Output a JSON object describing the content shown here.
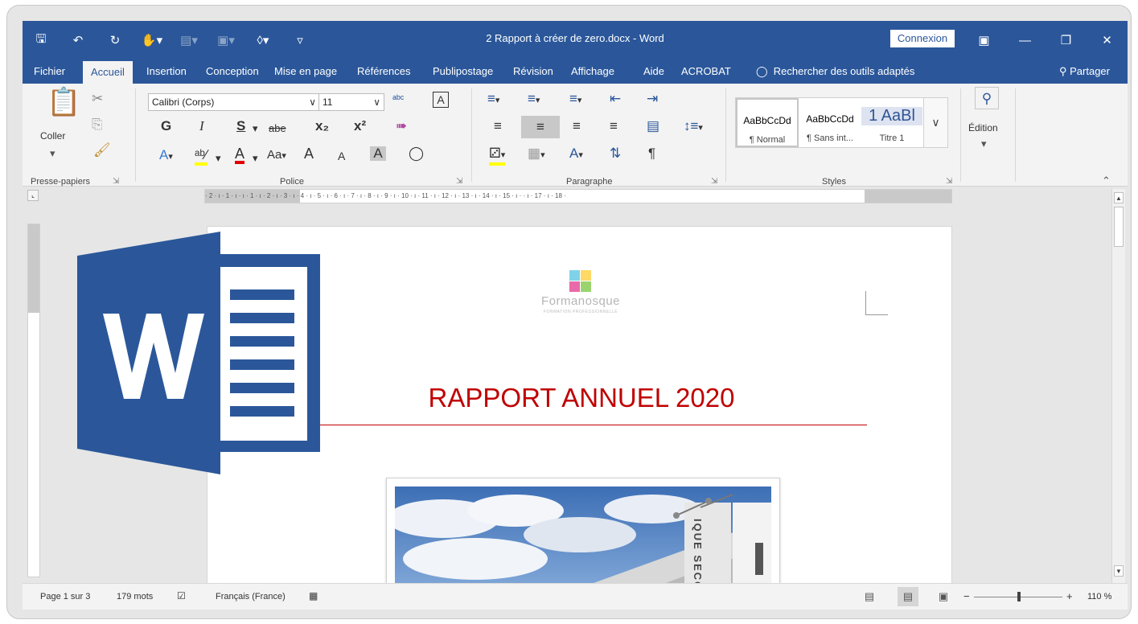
{
  "window": {
    "title": "2 Rapport à créer de zero.docx - Word",
    "signin_label": "Connexion"
  },
  "tabs": [
    "Fichier",
    "Accueil",
    "Insertion",
    "Conception",
    "Mise en page",
    "Références",
    "Publipostage",
    "Révision",
    "Affichage",
    "Aide",
    "ACROBAT"
  ],
  "tell_me": "Rechercher des outils adaptés",
  "share_label": "Partager",
  "ribbon": {
    "clipboard": {
      "paste_label": "Coller",
      "group_label": "Presse-papiers"
    },
    "font": {
      "font_name": "Calibri (Corps)",
      "font_size": "11",
      "bold": "G",
      "italic": "I",
      "underline": "S",
      "strike": "abe",
      "subscript": "x₂",
      "superscript": "x²",
      "case": "Aa",
      "grow": "A",
      "shrink": "A",
      "group_label": "Police"
    },
    "paragraph": {
      "group_label": "Paragraphe"
    },
    "styles": {
      "items": [
        {
          "sample": "AaBbCcDd",
          "name": "¶ Normal"
        },
        {
          "sample": "AaBbCcDd",
          "name": "¶ Sans int..."
        },
        {
          "sample": "1 AaBl",
          "name": "Titre 1"
        }
      ],
      "group_label": "Styles"
    },
    "editing": {
      "label": "Édition"
    }
  },
  "ruler_text": "· 2 · ı · 1 · ı ·   ı · 1 · ı · 2 · ı · 3 · ı · 4 · ı · 5 · ı · 6 · ı · 7 · ı · 8 · ı · 9 · ı · 10 · ı · 11 · ı · 12 · ı · 13 · ı · 14 · ı · 15 · ı ·   · ı · 17 · ı · 18 ·",
  "document": {
    "logo_name": "Formanosque",
    "logo_sub": "FORMATION PROFESSIONNELLE",
    "title": "RAPPORT ANNUEL 2020",
    "photo_sign": "IQUE SECOURS"
  },
  "status": {
    "page": "Page 1 sur 3",
    "words": "179 mots",
    "language": "Français (France)",
    "zoom": "110 %"
  },
  "colors": {
    "word_blue": "#2b579a",
    "title_red": "#c00000"
  }
}
